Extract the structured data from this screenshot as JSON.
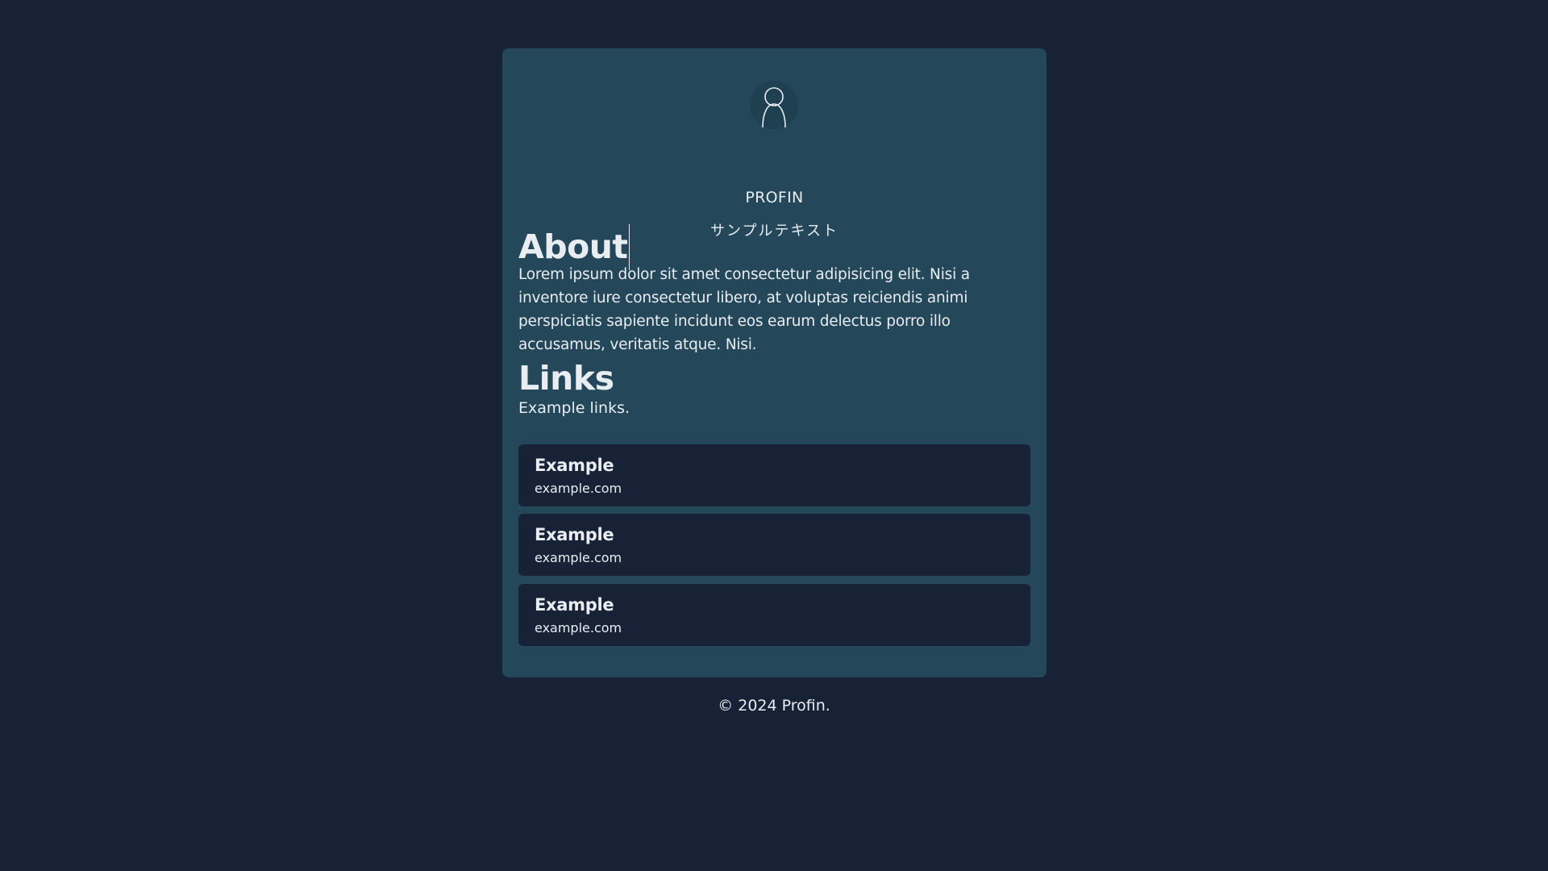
{
  "profile": {
    "name": "PROFIN",
    "subtitle": "サンプルテキスト"
  },
  "about": {
    "heading": "About",
    "text": "Lorem ipsum dolor sit amet consectetur adipisicing elit. Nisi a inventore iure consectetur libero, at voluptas reiciendis animi perspiciatis sapiente incidunt eos earum delectus porro illo accusamus, veritatis atque. Nisi."
  },
  "links": {
    "heading": "Links",
    "description": "Example links.",
    "items": [
      {
        "title": "Example",
        "url": "example.com"
      },
      {
        "title": "Example",
        "url": "example.com"
      },
      {
        "title": "Example",
        "url": "example.com"
      }
    ]
  },
  "footer": {
    "text": "© 2024 Profin."
  },
  "colors": {
    "background": "#182236",
    "card": "#24475a",
    "text": "#e8edf2"
  },
  "icons": {
    "avatar": "person-icon"
  }
}
